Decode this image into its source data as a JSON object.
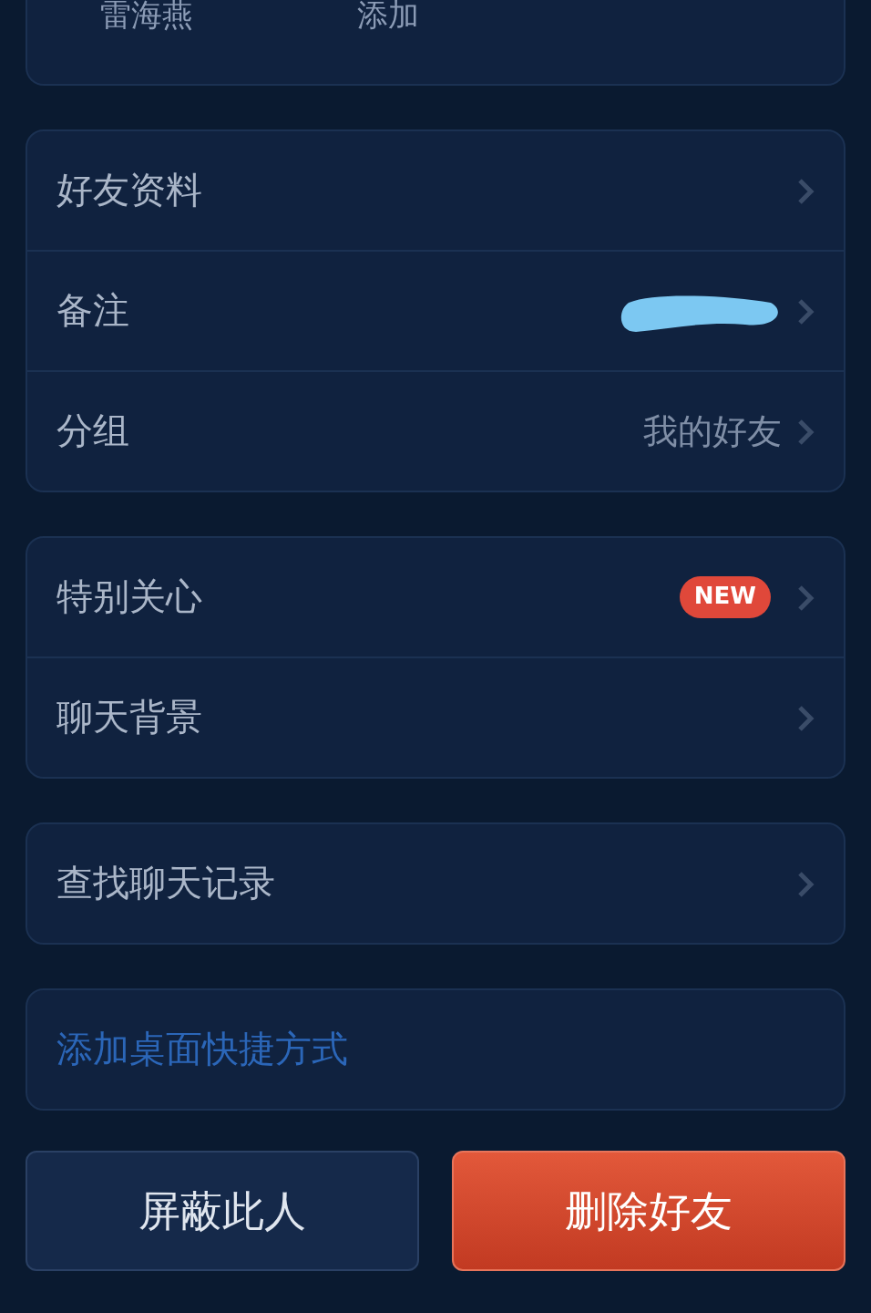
{
  "top_card": {
    "items": [
      "雷海燕",
      "添加"
    ]
  },
  "groups": [
    {
      "rows": [
        {
          "kind": "link",
          "label": "好友资料"
        },
        {
          "kind": "redacted",
          "label": "备注"
        },
        {
          "kind": "value",
          "label": "分组",
          "value": "我的好友"
        }
      ]
    },
    {
      "rows": [
        {
          "kind": "badge",
          "label": "特别关心",
          "badge": "NEW"
        },
        {
          "kind": "link",
          "label": "聊天背景"
        }
      ]
    },
    {
      "rows": [
        {
          "kind": "link",
          "label": "查找聊天记录"
        }
      ]
    },
    {
      "rows": [
        {
          "kind": "action",
          "label": "添加桌面快捷方式"
        }
      ]
    }
  ],
  "buttons": [
    {
      "kind": "secondary",
      "label": "屏蔽此人"
    },
    {
      "kind": "danger",
      "label": "删除好友"
    }
  ]
}
